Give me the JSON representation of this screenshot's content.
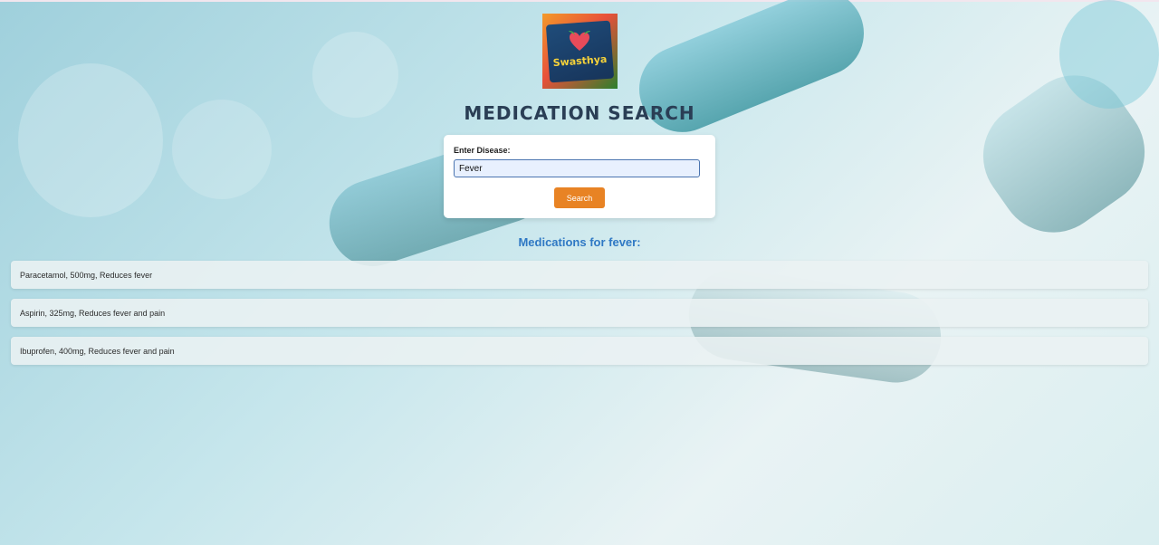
{
  "logo": {
    "text": "Swasthya",
    "icon": "heart-leaf-logo"
  },
  "page": {
    "title": "MEDICATION SEARCH"
  },
  "search": {
    "label": "Enter Disease:",
    "value": "Fever",
    "button_label": "Search"
  },
  "results": {
    "heading": "Medications for fever:",
    "items": [
      "Paracetamol, 500mg, Reduces fever",
      "Aspirin, 325mg, Reduces fever and pain",
      "Ibuprofen, 400mg, Reduces fever and pain"
    ]
  },
  "colors": {
    "title": "#2a3e55",
    "button": "#e88324",
    "heading": "#2f78c4"
  }
}
